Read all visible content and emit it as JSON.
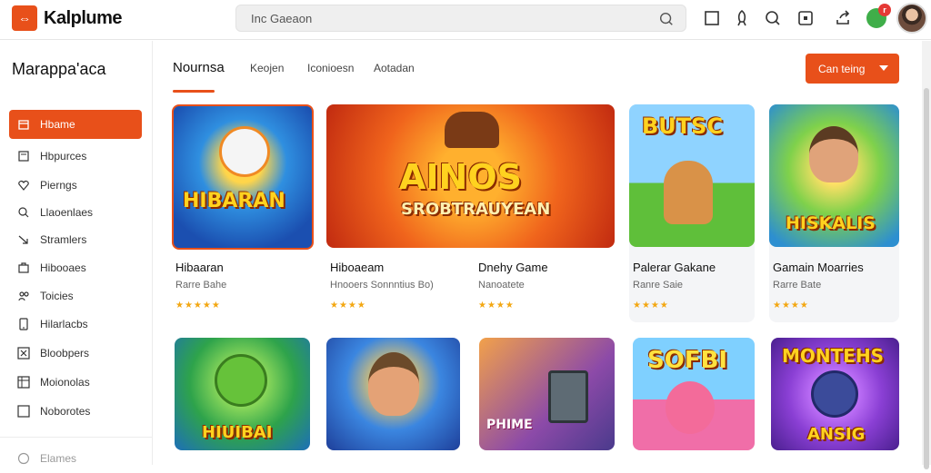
{
  "app": {
    "title": "Kalplume",
    "logo_glyph": "⇔"
  },
  "search": {
    "text": "Inc  Gaeaon"
  },
  "notifications": {
    "badge": "r"
  },
  "sidebar": {
    "title": "Marappa'aca",
    "items": [
      {
        "label": "Hbame",
        "icon": "home-icon",
        "active": true
      },
      {
        "label": "Hbpurces",
        "icon": "page-icon",
        "active": false
      },
      {
        "label": "Pierngs",
        "icon": "heart-icon",
        "active": false
      },
      {
        "label": "Llaoenlaes",
        "icon": "search-icon",
        "active": false
      },
      {
        "label": "Stramlers",
        "icon": "arrow-icon",
        "active": false
      },
      {
        "label": "Hibooaes",
        "icon": "bag-icon",
        "active": false
      },
      {
        "label": "Toicies",
        "icon": "people-icon",
        "active": false
      },
      {
        "label": "Hilarlacbs",
        "icon": "phone-icon",
        "active": false
      },
      {
        "label": "Bloobpers",
        "icon": "close-box-icon",
        "active": false
      },
      {
        "label": "Moionolas",
        "icon": "grid-icon",
        "active": false
      },
      {
        "label": "Noborotes",
        "icon": "square-icon",
        "active": false
      }
    ],
    "footer_label": "Elames"
  },
  "tabs": [
    {
      "label": "Nournsa",
      "active": true
    },
    {
      "label": "Keojen",
      "active": false
    },
    {
      "label": "Iconioesn",
      "active": false
    },
    {
      "label": "Aotadan",
      "active": false
    }
  ],
  "cta": {
    "label": "Can teing"
  },
  "row1": [
    {
      "title": "Hibaaran",
      "subtitle": "Rarre Bahe",
      "stars": "★★★★★",
      "art": "HIBARAN"
    },
    {
      "title": "Hiboaeam",
      "subtitle": "Hnooers Sonnntius Bo)",
      "stars": "★★★★",
      "art": "AINOS"
    },
    {
      "title": "Dnehy Game",
      "subtitle": "Nanoatete",
      "stars": "★★★★",
      "art": ""
    },
    {
      "title": "Palerar Gakane",
      "subtitle": "Ranre Saie",
      "stars": "★★★★",
      "art": "BUTSC"
    },
    {
      "title": "Gamain Moarries",
      "subtitle": "Rarre Bate",
      "stars": "★★★★",
      "art": "HISKALIS"
    }
  ],
  "row1_art_sub": "SROBTRAUYEAN",
  "row2": [
    {
      "art": "HIUIBAI"
    },
    {
      "art": ""
    },
    {
      "art": "PHIME"
    },
    {
      "art": "SOFBI"
    },
    {
      "art": "MONTEHS"
    }
  ],
  "row2_art_sub_last": "ANSIG",
  "colors": {
    "accent": "#e8501a",
    "star": "#f3a712"
  }
}
